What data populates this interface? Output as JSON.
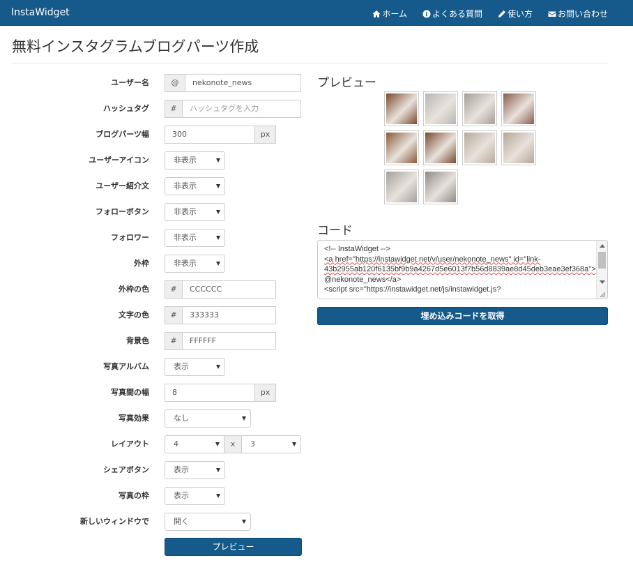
{
  "navbar": {
    "brand": "InstaWidget",
    "items": [
      {
        "label": "ホーム",
        "icon": "home-icon"
      },
      {
        "label": "よくある質問",
        "icon": "info-circle-icon"
      },
      {
        "label": "使い方",
        "icon": "pencil-icon"
      },
      {
        "label": "お問い合わせ",
        "icon": "envelope-icon"
      }
    ]
  },
  "page_title": "無料インスタグラムブログパーツ作成",
  "form": {
    "username": {
      "label": "ユーザー名",
      "addon": "@",
      "value": "nekonote_news"
    },
    "hashtag": {
      "label": "ハッシュタグ",
      "addon": "#",
      "placeholder": "ハッシュタグを入力"
    },
    "width": {
      "label": "ブログパーツ幅",
      "value": "300",
      "unit": "px"
    },
    "user_icon": {
      "label": "ユーザーアイコン",
      "value": "非表示"
    },
    "user_bio": {
      "label": "ユーザー紹介文",
      "value": "非表示"
    },
    "follow_button": {
      "label": "フォローボタン",
      "value": "非表示"
    },
    "followers": {
      "label": "フォロワー",
      "value": "非表示"
    },
    "outer_border": {
      "label": "外枠",
      "value": "非表示"
    },
    "border_color": {
      "label": "外枠の色",
      "addon": "#",
      "value": "CCCCCC"
    },
    "text_color": {
      "label": "文字の色",
      "addon": "#",
      "value": "333333"
    },
    "bg_color": {
      "label": "背景色",
      "addon": "#",
      "value": "FFFFFF"
    },
    "album": {
      "label": "写真アルバム",
      "value": "表示"
    },
    "photo_gap": {
      "label": "写真間の幅",
      "value": "8",
      "unit": "px"
    },
    "photo_effect": {
      "label": "写真効果",
      "value": "なし"
    },
    "layout": {
      "label": "レイアウト",
      "cols": "4",
      "times": "x",
      "rows": "3"
    },
    "share_button": {
      "label": "シェアボタン",
      "value": "表示"
    },
    "photo_frame": {
      "label": "写真の枠",
      "value": "表示"
    },
    "new_window": {
      "label": "新しいウィンドウで",
      "value": "開く"
    },
    "preview_button": "プレビュー"
  },
  "preview": {
    "title": "プレビュー"
  },
  "code": {
    "title": "コード",
    "lines": [
      "<!-- InstaWidget -->",
      "<a href=\"https://instawidget.net/v/user/nekonote_news\" id=\"link-",
      "43b2955ab120f6135bf9b9a4267d5e6013f7b56d8839ae8d45deb3eae3ef368a\">",
      "@nekonote_news</a>",
      "<script src=\"https://instawidget.net/js/instawidget.js?"
    ],
    "button": "埋め込みコードを取得"
  },
  "colors": {
    "navbar": "#155a8a",
    "primary_button": "#155a8a",
    "thumbs": [
      "#7a4a2e",
      "#b9b6b4",
      "#a59f98",
      "#8c5c4e",
      "#8a5a3a",
      "#7a4a30",
      "#b7aa9c",
      "#b5a696",
      "#a3a09d",
      "#8d8a87"
    ]
  }
}
